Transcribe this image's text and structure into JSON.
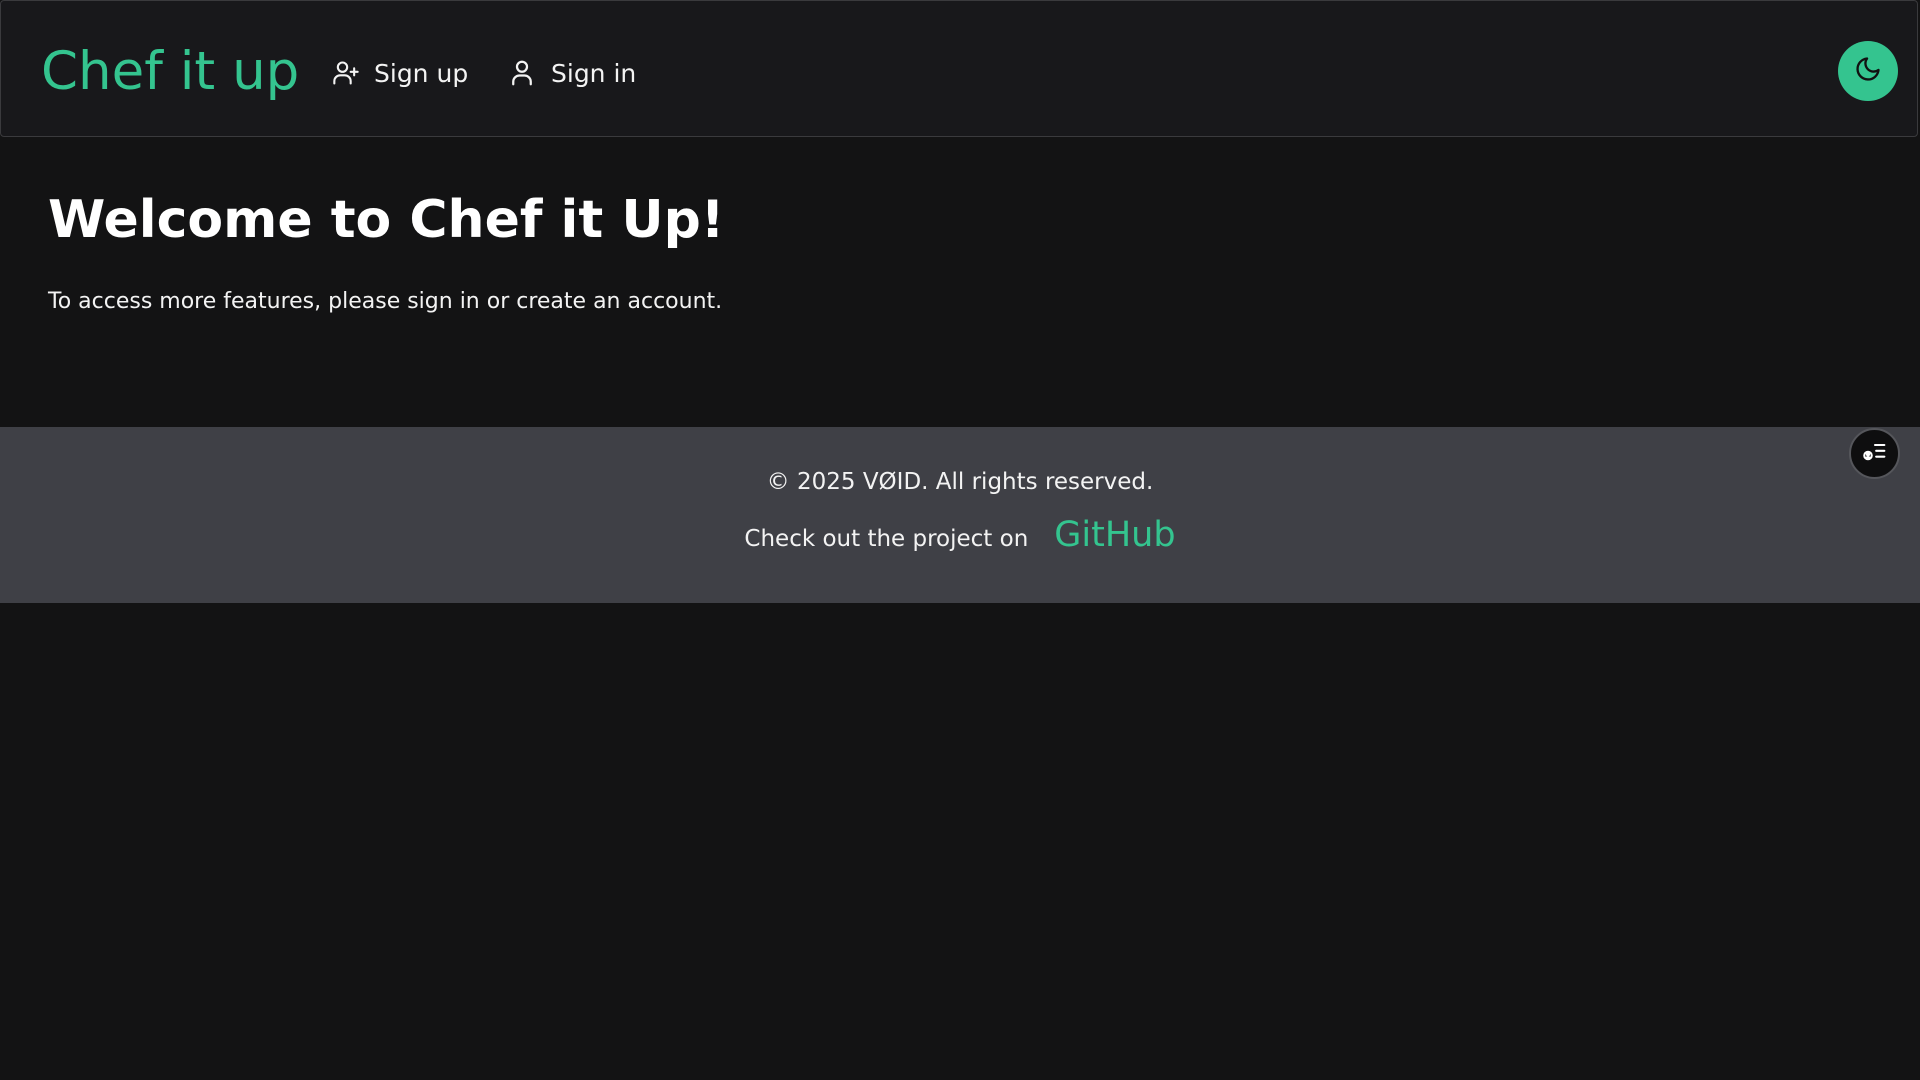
{
  "header": {
    "brand": "Chef it up",
    "nav": [
      {
        "label": "Sign up",
        "icon": "user-plus-icon"
      },
      {
        "label": "Sign in",
        "icon": "user-icon"
      }
    ],
    "theme_toggle_icon": "moon-icon"
  },
  "main": {
    "title": "Welcome to Chef it Up!",
    "message": "To access more features, please sign in or create an account."
  },
  "footer": {
    "copyright": "© 2025 VØID. All rights reserved.",
    "project_text": "Check out the project on",
    "github_label": "GitHub"
  },
  "floating_button_icon": "profile-menu-icon",
  "colors": {
    "accent": "#34c48f",
    "background": "#131314",
    "header_background": "#18181b",
    "footer_background": "#3f4046",
    "text": "#ffffff"
  }
}
